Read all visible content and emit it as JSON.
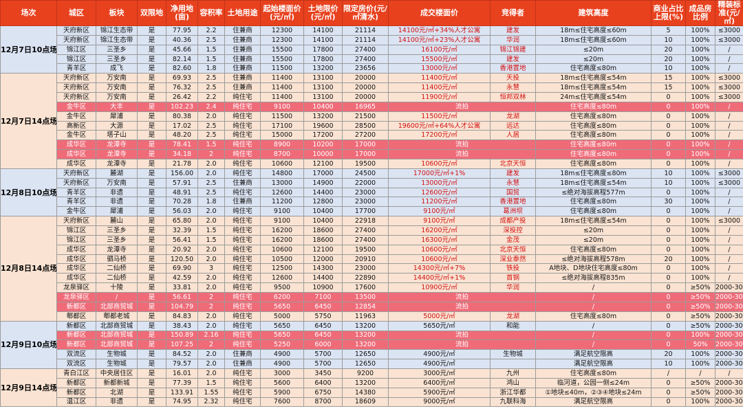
{
  "headers": [
    "场次",
    "城区",
    "板块",
    "双限地",
    "净用地(亩)",
    "容积率",
    "土地用途",
    "起始楼面价(元/㎡)",
    "土地限价(元/㎡)",
    "限定房价(元/㎡清水)",
    "成交楼面价",
    "竞得者",
    "建筑高度",
    "商业占比上限(%)",
    "成品房比例",
    "精装标准(元/㎡)"
  ],
  "sessions": [
    {
      "label": "12月7日10点场",
      "rows": [
        {
          "c": [
            "天府新区",
            "锦江生态带",
            "是",
            "77.95",
            "2.2",
            "住兼商",
            "12300",
            "14100",
            "21114",
            "14100元/㎡+34%人才公寓",
            "建发",
            "18m≤住宅高度≤60m",
            "5",
            "100%",
            "≤3000"
          ],
          "red": [
            9,
            10
          ]
        },
        {
          "c": [
            "天府新区",
            "锦江生态带",
            "是",
            "40.36",
            "2.5",
            "住兼商",
            "12300",
            "14100",
            "21114",
            "14100元/㎡+23%人才公寓",
            "华润",
            "18m≤住宅高度≤60m",
            "10",
            "100%",
            "≤3000"
          ],
          "red": [
            9,
            10
          ]
        },
        {
          "c": [
            "锦江区",
            "三圣乡",
            "是",
            "45.66",
            "1.5",
            "住兼商",
            "15500",
            "17800",
            "27400",
            "16100元/㎡",
            "锦江锦建",
            "≤20m",
            "20",
            "100%",
            "/"
          ],
          "red": [
            9,
            10
          ]
        },
        {
          "c": [
            "锦江区",
            "三圣乡",
            "是",
            "82.14",
            "1.5",
            "住兼商",
            "15500",
            "17800",
            "27400",
            "15500元/㎡",
            "建发",
            "≤20m",
            "20",
            "100%",
            "/"
          ],
          "red": [
            9,
            10
          ]
        },
        {
          "c": [
            "青羊区",
            "成飞",
            "是",
            "82.60",
            "1.8",
            "住兼商",
            "11500",
            "13200",
            "23656",
            "13000元/㎡",
            "香港置地",
            "住宅高度≤80m",
            "10",
            "100%",
            "/"
          ],
          "red": [
            9,
            10
          ]
        }
      ]
    },
    {
      "label": "12月7日14点场",
      "rows": [
        {
          "c": [
            "天府新区",
            "万安南",
            "是",
            "69.93",
            "2.5",
            "住兼商",
            "11400",
            "13100",
            "20000",
            "11400元/㎡",
            "天投",
            "18m≤住宅高度≤54m",
            "15",
            "100%",
            "≤3000"
          ],
          "red": [
            9,
            10
          ]
        },
        {
          "c": [
            "天府新区",
            "万安南",
            "是",
            "76.32",
            "2.5",
            "住兼商",
            "11400",
            "13100",
            "20000",
            "11400元/㎡",
            "永慧",
            "18m≤住宅高度≤54m",
            "15",
            "100%",
            "≤3000"
          ],
          "red": [
            9,
            10
          ]
        },
        {
          "c": [
            "天府新区",
            "万安南",
            "是",
            "26.42",
            "2.2",
            "纯住宅",
            "11400",
            "13100",
            "20000",
            "11900元/㎡",
            "恒邦双林",
            "24m≤住宅高度≤54m",
            "0",
            "100%",
            "≤3000"
          ],
          "red": [
            9,
            10
          ]
        },
        {
          "c": [
            "金牛区",
            "大丰",
            "是",
            "102.23",
            "2.4",
            "纯住宅",
            "9100",
            "10400",
            "16965",
            "流拍",
            "",
            "住宅高度≤80m",
            "0",
            "100%",
            "/"
          ],
          "fail": true
        },
        {
          "c": [
            "金牛区",
            "犀浦",
            "是",
            "80.38",
            "2.0",
            "纯住宅",
            "11500",
            "13200",
            "21500",
            "11500元/㎡",
            "龙湖",
            "住宅高度≤80m",
            "0",
            "100%",
            "/"
          ],
          "red": [
            9,
            10
          ]
        },
        {
          "c": [
            "高新区",
            "大源",
            "是",
            "17.02",
            "2.5",
            "纯住宅",
            "17100",
            "19600",
            "28500",
            "19600元/㎡+64%人才公寓",
            "远达",
            "住宅高度≤80m",
            "0",
            "100%",
            "/"
          ],
          "red": [
            9,
            10
          ]
        },
        {
          "c": [
            "金牛区",
            "塔子山",
            "是",
            "48.20",
            "2.5",
            "纯住宅",
            "15000",
            "17200",
            "27200",
            "17200元/㎡",
            "人居",
            "住宅高度≤80m",
            "0",
            "100%",
            "/"
          ],
          "red": [
            9,
            10
          ]
        },
        {
          "c": [
            "成华区",
            "龙潭寺",
            "是",
            "78.41",
            "1.5",
            "纯住宅",
            "8900",
            "10200",
            "17000",
            "流拍",
            "",
            "住宅高度≤80m",
            "0",
            "100%",
            "/"
          ],
          "fail": true
        },
        {
          "c": [
            "成华区",
            "龙潭寺",
            "是",
            "34.18",
            "2",
            "纯住宅",
            "8700",
            "10000",
            "17000",
            "流拍",
            "",
            "住宅高度≤80m",
            "0",
            "100%",
            "/"
          ],
          "fail": true
        },
        {
          "c": [
            "成华区",
            "龙潭寺",
            "是",
            "21.78",
            "2.0",
            "纯住宅",
            "10600",
            "12100",
            "19500",
            "10600元/㎡",
            "北京天恒",
            "住宅高度≤80m",
            "0",
            "100%",
            "/"
          ],
          "red": [
            9,
            10
          ]
        }
      ]
    },
    {
      "label": "12月8日10点场",
      "rows": [
        {
          "c": [
            "天府新区",
            "麓湖",
            "是",
            "156.00",
            "2.0",
            "纯住宅",
            "14800",
            "17000",
            "24500",
            "17000元/㎡+1%",
            "建发",
            "18m≤住宅高度≤80m",
            "10",
            "100%",
            "≤3000"
          ],
          "red": [
            9,
            10
          ]
        },
        {
          "c": [
            "天府新区",
            "万安南",
            "是",
            "57.91",
            "2.5",
            "住兼商",
            "13000",
            "14900",
            "22000",
            "13000元/㎡",
            "永慧",
            "18m≤住宅高度≤54m",
            "10",
            "100%",
            "≤3000"
          ],
          "red": [
            9,
            10
          ]
        },
        {
          "c": [
            "青羊区",
            "非遗",
            "是",
            "48.91",
            "2.5",
            "纯住宅",
            "12600",
            "14400",
            "23000",
            "12600元/㎡",
            "国贸",
            "≤绝对海拔高程577m",
            "0",
            "100%",
            "/"
          ],
          "red": [
            9,
            10
          ]
        },
        {
          "c": [
            "青羊区",
            "非遗",
            "是",
            "70.28",
            "1.8",
            "住兼商",
            "11200",
            "12800",
            "23000",
            "11200元/㎡",
            "香港置地",
            "住宅高度≤80m",
            "30",
            "100%",
            "/"
          ],
          "red": [
            9,
            10
          ]
        },
        {
          "c": [
            "金牛区",
            "犀浦",
            "是",
            "56.03",
            "2.0",
            "纯住宅",
            "9100",
            "10400",
            "17700",
            "9100元/㎡",
            "葛洲坝",
            "住宅高度≤80m",
            "0",
            "100%",
            "/"
          ],
          "red": [
            9,
            10
          ]
        }
      ]
    },
    {
      "label": "12月8日14点场",
      "rows": [
        {
          "c": [
            "天府新区",
            "麓山",
            "是",
            "65.80",
            "2.0",
            "纯住宅",
            "9100",
            "10400",
            "22918",
            "9100元/㎡",
            "成都产投",
            "18m≤住宅高度≤54m",
            "0",
            "100%",
            "≤3000"
          ],
          "red": [
            9,
            10
          ]
        },
        {
          "c": [
            "锦江区",
            "三圣乡",
            "是",
            "32.39",
            "1.5",
            "纯住宅",
            "16200",
            "18600",
            "27400",
            "16200元/㎡",
            "深投控",
            "≤20m",
            "0",
            "100%",
            "/"
          ],
          "red": [
            9,
            10
          ]
        },
        {
          "c": [
            "锦江区",
            "三圣乡",
            "是",
            "56.41",
            "1.5",
            "纯住宅",
            "16200",
            "18600",
            "27400",
            "16300元/㎡",
            "金茂",
            "≤20m",
            "0",
            "100%",
            "/"
          ],
          "red": [
            9,
            10
          ]
        },
        {
          "c": [
            "成华区",
            "龙潭寺",
            "是",
            "20.92",
            "2.0",
            "纯住宅",
            "10600",
            "12100",
            "19500",
            "10600元/㎡",
            "北京天恒",
            "住宅高度≤80m",
            "0",
            "100%",
            "/"
          ],
          "red": [
            9,
            10
          ]
        },
        {
          "c": [
            "成华区",
            "驷马桥",
            "是",
            "120.50",
            "2.0",
            "纯住宅",
            "10500",
            "12000",
            "20910",
            "10600元/㎡",
            "深业泰然",
            "≤绝对海拔高程578m",
            "20",
            "100%",
            "/"
          ],
          "red": [
            9,
            10
          ]
        },
        {
          "c": [
            "成华区",
            "二仙桥",
            "是",
            "69.90",
            "3",
            "纯住宅",
            "12500",
            "14300",
            "23000",
            "14300元/㎡+7%",
            "铁投",
            "A地块、D地块住宅高度≤80m",
            "0",
            "100%",
            "/"
          ],
          "red": [
            9,
            10
          ]
        },
        {
          "c": [
            "成华区",
            "二仙桥",
            "是",
            "42.59",
            "2.0",
            "纯住宅",
            "12600",
            "14400",
            "22890",
            "14400元/㎡+1%",
            "首钢",
            "≤绝对海拔高程835m",
            "0",
            "100%",
            "/"
          ],
          "red": [
            9,
            10
          ]
        },
        {
          "c": [
            "龙泉驿区",
            "十陵",
            "是",
            "33.81",
            "2.0",
            "纯住宅",
            "9500",
            "10900",
            "17600",
            "10900元/㎡",
            "华润",
            "/",
            "0",
            "≥50%",
            "2000-3000"
          ],
          "red": [
            9,
            10
          ]
        },
        {
          "c": [
            "龙泉驿区",
            "/",
            "是",
            "56.61",
            "2",
            "纯住宅",
            "6200",
            "7100",
            "13500",
            "流拍",
            "",
            "/",
            "0",
            "≥50%",
            "2000-3000"
          ],
          "fail": true
        },
        {
          "c": [
            "新都区",
            "北部商贸城",
            "是",
            "104.79",
            "2",
            "纯住宅",
            "5650",
            "6450",
            "12854",
            "流拍",
            "",
            "/",
            "0",
            "≥50%",
            "2000-3000"
          ],
          "fail": true
        },
        {
          "c": [
            "郫都区",
            "郫都老城",
            "是",
            "84.83",
            "2.0",
            "纯住宅",
            "5000",
            "5750",
            "11963",
            "5000元/㎡",
            "龙湖",
            "住宅高度≤80m",
            "0",
            "≥50%",
            "2000-3000"
          ],
          "red": [
            9,
            10
          ]
        }
      ]
    },
    {
      "label": "12月9日10点场",
      "rows": [
        {
          "c": [
            "新都区",
            "北部商贸城",
            "是",
            "38.43",
            "2.0",
            "纯住宅",
            "5650",
            "6450",
            "13200",
            "5650元/㎡",
            "和能",
            "/",
            "0",
            "≥50%",
            "2000-3000"
          ],
          "red": []
        },
        {
          "c": [
            "新都区",
            "北部商贸城",
            "是",
            "150.89",
            "2.16",
            "纯住宅",
            "5650",
            "6450",
            "13200",
            "流拍",
            "",
            "/",
            "0",
            "100%",
            "2000-3000"
          ],
          "fail": true
        },
        {
          "c": [
            "新都区",
            "北部商贸城",
            "是",
            "107.25",
            "2",
            "纯住宅",
            "5250",
            "6000",
            "13200",
            "流拍",
            "",
            "/",
            "0",
            "50%",
            "2000-3000"
          ],
          "fail": true
        },
        {
          "c": [
            "双流区",
            "生物城",
            "是",
            "84.52",
            "2.0",
            "住兼商",
            "4900",
            "5700",
            "12650",
            "4900元/㎡",
            "生物城",
            "满足航空限高",
            "20",
            "100%",
            "2000-3000"
          ],
          "red": []
        },
        {
          "c": [
            "双流区",
            "生物城",
            "是",
            "79.57",
            "2.0",
            "住兼商",
            "4900",
            "5700",
            "12650",
            "4900元/㎡",
            "",
            "满足航空限高",
            "10",
            "100%",
            "2000-3000"
          ],
          "red": []
        }
      ]
    },
    {
      "label": "12月9日14点场",
      "rows": [
        {
          "c": [
            "青白江区",
            "中央居住区",
            "是",
            "16.01",
            "2.0",
            "纯住宅",
            "3000",
            "3450",
            "9200",
            "3000元/㎡",
            "九州",
            "住宅高度≤80m",
            "/",
            "/",
            "/"
          ],
          "red": []
        },
        {
          "c": [
            "新都区",
            "新都新城",
            "是",
            "77.39",
            "1.5",
            "纯住宅",
            "5600",
            "6400",
            "13200",
            "6400元/㎡",
            "鸿山",
            "临河道，公园一侧≤24m",
            "0",
            "≥50%",
            "2000-3000"
          ],
          "red": []
        },
        {
          "c": [
            "新都区",
            "北湖",
            "是",
            "133.91",
            "1.55",
            "纯住宅",
            "5900",
            "6750",
            "14380",
            "5900元/㎡",
            "浙江华都",
            "①地块≤40m，②③④地块≤24m",
            "0",
            "≥50%",
            "2000-3000"
          ],
          "red": []
        },
        {
          "c": [
            "温江区",
            "非遗",
            "是",
            "74.95",
            "2.32",
            "纯住宅",
            "7600",
            "8700",
            "18609",
            "9000元/㎡",
            "九联科海",
            "满足航空限高",
            "0",
            "100%",
            "2000-3000"
          ],
          "red": []
        }
      ]
    }
  ]
}
